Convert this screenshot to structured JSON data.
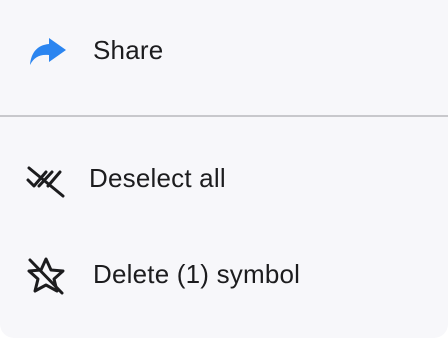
{
  "menu": {
    "items": [
      {
        "label": "Share",
        "icon": "share-arrow-icon"
      },
      {
        "label": "Deselect all",
        "icon": "deselect-all-icon"
      },
      {
        "label": "Delete (1) symbol",
        "icon": "star-slash-icon"
      }
    ]
  },
  "colors": {
    "accent": "#2b85f0",
    "text": "#1c1c1e",
    "divider": "#c8c8cc",
    "background": "#f7f7fa"
  }
}
